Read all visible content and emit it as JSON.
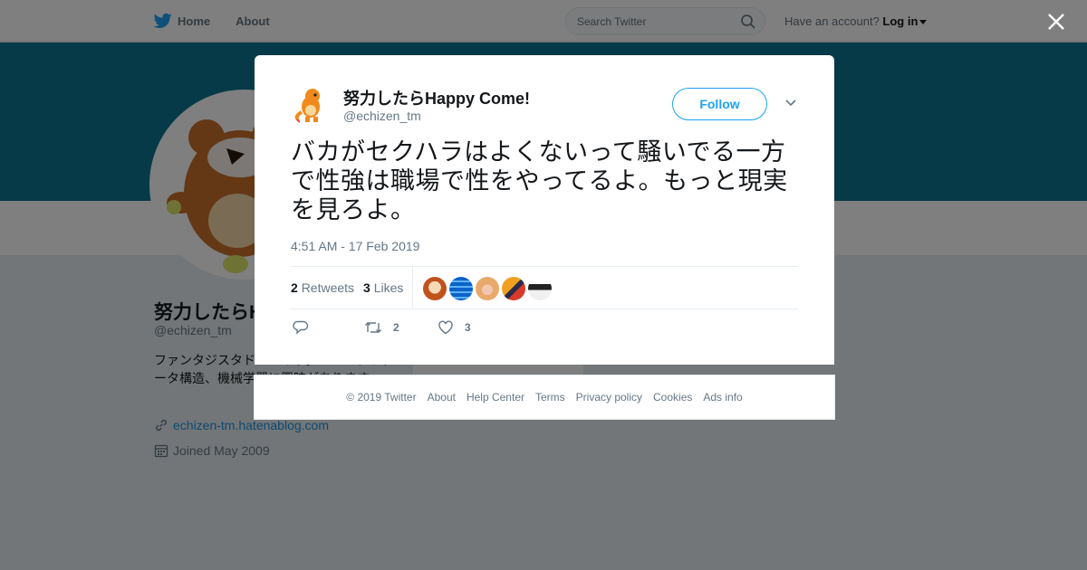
{
  "nav": {
    "home_label": "Home",
    "about_label": "About",
    "search_placeholder": "Search Twitter",
    "have_account": "Have an account?",
    "login_label": "Log in"
  },
  "profile": {
    "name": "努力したらHappy Come!",
    "handle": "@echizen_tm",
    "bio": "ファンタジスタドールイヴ。コンパクトデータ構造、機械学習に興味があります。",
    "link": "echizen-tm.hatenablog.com",
    "joined": "Joined May 2009"
  },
  "tweet": {
    "author_name": "努力したらHappy Come!",
    "author_handle": "@echizen_tm",
    "follow_label": "Follow",
    "text": "バカがセクハラはよくないって騒いでる一方で性強は職場で性をやってるよ。もっと現実を見ろよ。",
    "timestamp": "4:51 AM - 17 Feb 2019",
    "retweets_count": "2",
    "retweets_label": "Retweets",
    "likes_count": "3",
    "likes_label": "Likes",
    "reply_count": "",
    "retweet_action_count": "2",
    "like_action_count": "3",
    "liker_avatars": [
      "anime-girl-avatar",
      "blue-globe-avatar",
      "blonde-girl-avatar",
      "masked-hero-avatar",
      "dark-hat-avatar"
    ]
  },
  "footer": {
    "copyright": "© 2019 Twitter",
    "links": [
      "About",
      "Help Center",
      "Terms",
      "Privacy policy",
      "Cookies",
      "Ads info"
    ]
  },
  "colors": {
    "brand_blue": "#1da1f2",
    "banner_teal": "#0e7490",
    "muted_text": "#657786"
  }
}
